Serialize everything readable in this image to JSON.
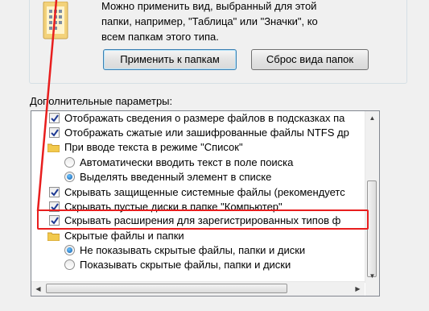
{
  "folder_views": {
    "description": "Можно применить вид, выбранный для этой\nпапки, например, \"Таблица\" или \"Значки\", ко\nвсем папкам этого типа.",
    "apply_button": "Применить к папкам",
    "reset_button": "Сброс вида папок"
  },
  "advanced": {
    "label": "Дополнительные параметры:",
    "items": [
      {
        "type": "checkbox",
        "checked": true,
        "label": "Отображать сведения о размере файлов в подсказках па"
      },
      {
        "type": "checkbox",
        "checked": true,
        "label": "Отображать сжатые или зашифрованные файлы NTFS др"
      },
      {
        "type": "folder",
        "label": "При вводе текста в режиме \"Список\""
      },
      {
        "type": "radio",
        "checked": false,
        "label": "Автоматически вводить текст в поле поиска"
      },
      {
        "type": "radio",
        "checked": true,
        "label": "Выделять введенный элемент в списке"
      },
      {
        "type": "checkbox",
        "checked": true,
        "label": "Скрывать защищенные системные файлы (рекомендуетс"
      },
      {
        "type": "checkbox",
        "checked": true,
        "label": "Скрывать пустые диски в папке \"Компьютер\""
      },
      {
        "type": "checkbox",
        "checked": true,
        "label": "Скрывать расширения для зарегистрированных типов ф"
      },
      {
        "type": "folder",
        "label": "Скрытые файлы и папки"
      },
      {
        "type": "radio",
        "checked": true,
        "label": "Не показывать скрытые файлы, папки и диски"
      },
      {
        "type": "radio",
        "checked": false,
        "label": "Показывать скрытые файлы, папки и диски"
      }
    ]
  },
  "colors": {
    "highlight": "#e81e1e",
    "window_bg": "#f0f0f0"
  }
}
